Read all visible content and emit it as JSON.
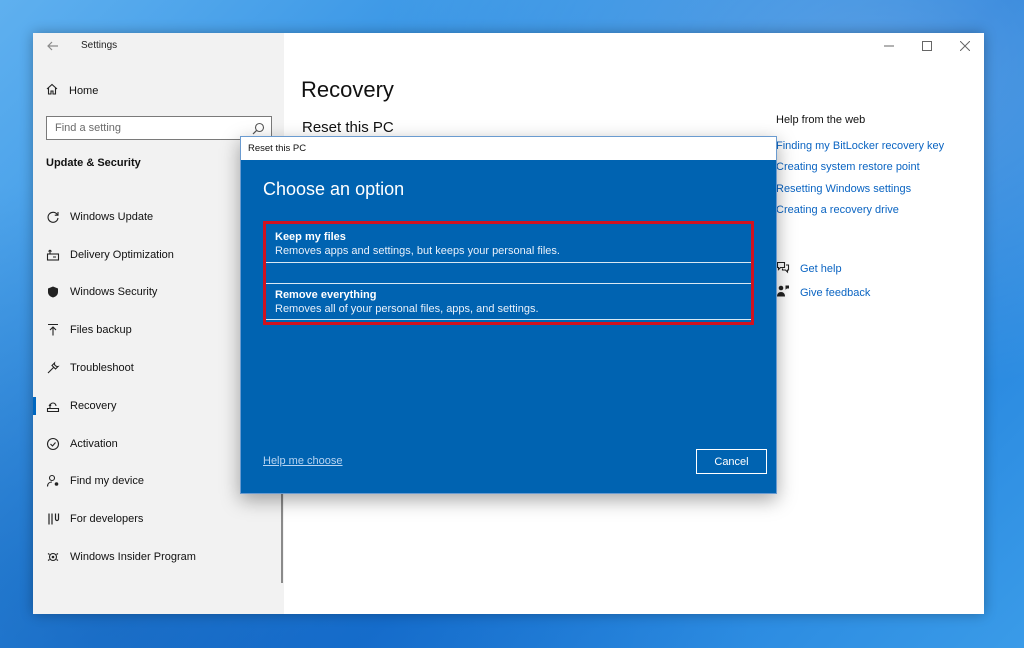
{
  "settings": {
    "app_title": "Settings",
    "home_label": "Home",
    "search_placeholder": "Find a setting",
    "section_heading": "Update & Security",
    "nav_items": [
      {
        "label": "Windows Update",
        "icon": "refresh-icon"
      },
      {
        "label": "Delivery Optimization",
        "icon": "delivery-icon"
      },
      {
        "label": "Windows Security",
        "icon": "shield-icon"
      },
      {
        "label": "Files backup",
        "icon": "upload-arrow-icon"
      },
      {
        "label": "Troubleshoot",
        "icon": "wrench-icon"
      },
      {
        "label": "Recovery",
        "icon": "recovery-icon",
        "active": true
      },
      {
        "label": "Activation",
        "icon": "check-circle-icon"
      },
      {
        "label": "Find my device",
        "icon": "person-location-icon"
      },
      {
        "label": "For developers",
        "icon": "developer-icon"
      },
      {
        "label": "Windows Insider Program",
        "icon": "insider-icon"
      }
    ]
  },
  "main": {
    "title": "Recovery",
    "subtitle": "Reset this PC"
  },
  "help": {
    "heading": "Help from the web",
    "links": [
      "Finding my BitLocker recovery key",
      "Creating system restore point",
      "Resetting Windows settings",
      "Creating a recovery drive"
    ],
    "get_help": "Get help",
    "give_feedback": "Give feedback"
  },
  "dialog": {
    "title": "Reset this PC",
    "heading": "Choose an option",
    "options": [
      {
        "title": "Keep my files",
        "description": "Removes apps and settings, but keeps your personal files."
      },
      {
        "title": "Remove everything",
        "description": "Removes all of your personal files, apps, and settings."
      }
    ],
    "help_link": "Help me choose",
    "cancel_label": "Cancel"
  },
  "colors": {
    "dialog_bg": "#0063b1",
    "accent": "#0067c0",
    "link": "#0a64c2",
    "highlight": "#d1121f"
  }
}
